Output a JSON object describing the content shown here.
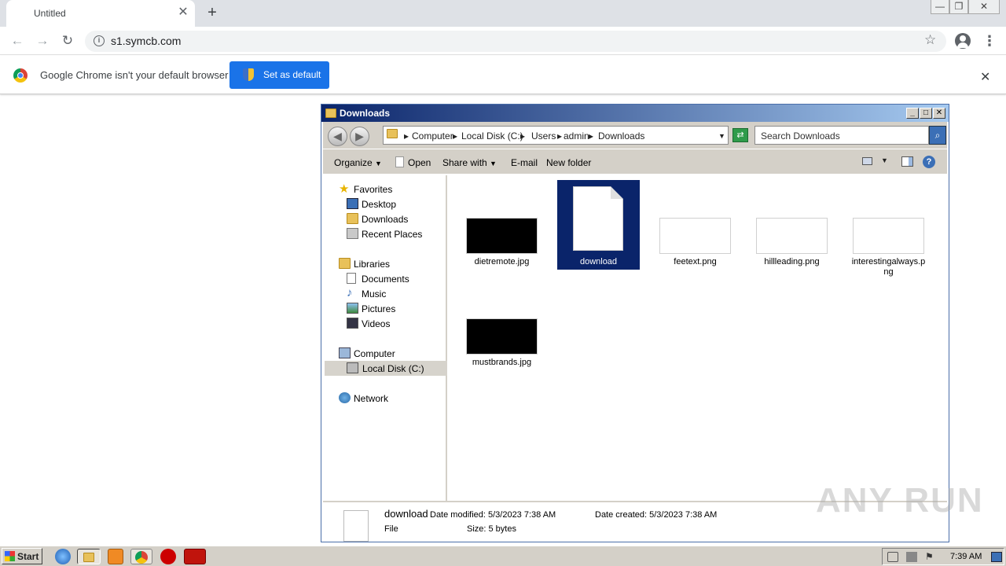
{
  "browser": {
    "tab": {
      "title": "Untitled",
      "close": "✕"
    },
    "new_tab": "+",
    "window_controls": {
      "minimize": "—",
      "restore": "❐",
      "close": "✕"
    },
    "nav": {
      "back": "←",
      "forward": "→",
      "reload": "↻"
    },
    "address": {
      "info": "i",
      "url": "s1.symcb.com",
      "star": "☆"
    },
    "menu": "⋮",
    "infobar": {
      "message": "Google Chrome isn't your default browser",
      "button": "Set as default",
      "close": "✕"
    }
  },
  "explorer": {
    "title": "Downloads",
    "controls": {
      "minimize": "_",
      "maximize": "□",
      "close": "✕"
    },
    "breadcrumb": [
      "Computer",
      "Local Disk (C:)",
      "Users",
      "admin",
      "Downloads"
    ],
    "search_placeholder": "Search Downloads",
    "commands": {
      "organize": "Organize",
      "open": "Open",
      "share": "Share with",
      "email": "E-mail",
      "new_folder": "New folder"
    },
    "nav": {
      "favorites": "Favorites",
      "desktop": "Desktop",
      "downloads": "Downloads",
      "recent": "Recent Places",
      "libraries": "Libraries",
      "documents": "Documents",
      "music": "Music",
      "pictures": "Pictures",
      "videos": "Videos",
      "computer": "Computer",
      "local_disk": "Local Disk (C:)",
      "network": "Network"
    },
    "files": [
      {
        "name": "dietremote.jpg"
      },
      {
        "name": "download"
      },
      {
        "name": "feetext.png"
      },
      {
        "name": "hillleading.png"
      },
      {
        "name": "interestingalways.png"
      },
      {
        "name": "mustbrands.jpg"
      }
    ],
    "details": {
      "name": "download",
      "type": "File",
      "modified": "Date modified: 5/3/2023 7:38 AM",
      "created": "Date created: 5/3/2023 7:38 AM",
      "size": "Size: 5 bytes"
    }
  },
  "taskbar": {
    "start": "Start",
    "clock": "7:39 AM"
  },
  "watermark": "ANY RUN"
}
